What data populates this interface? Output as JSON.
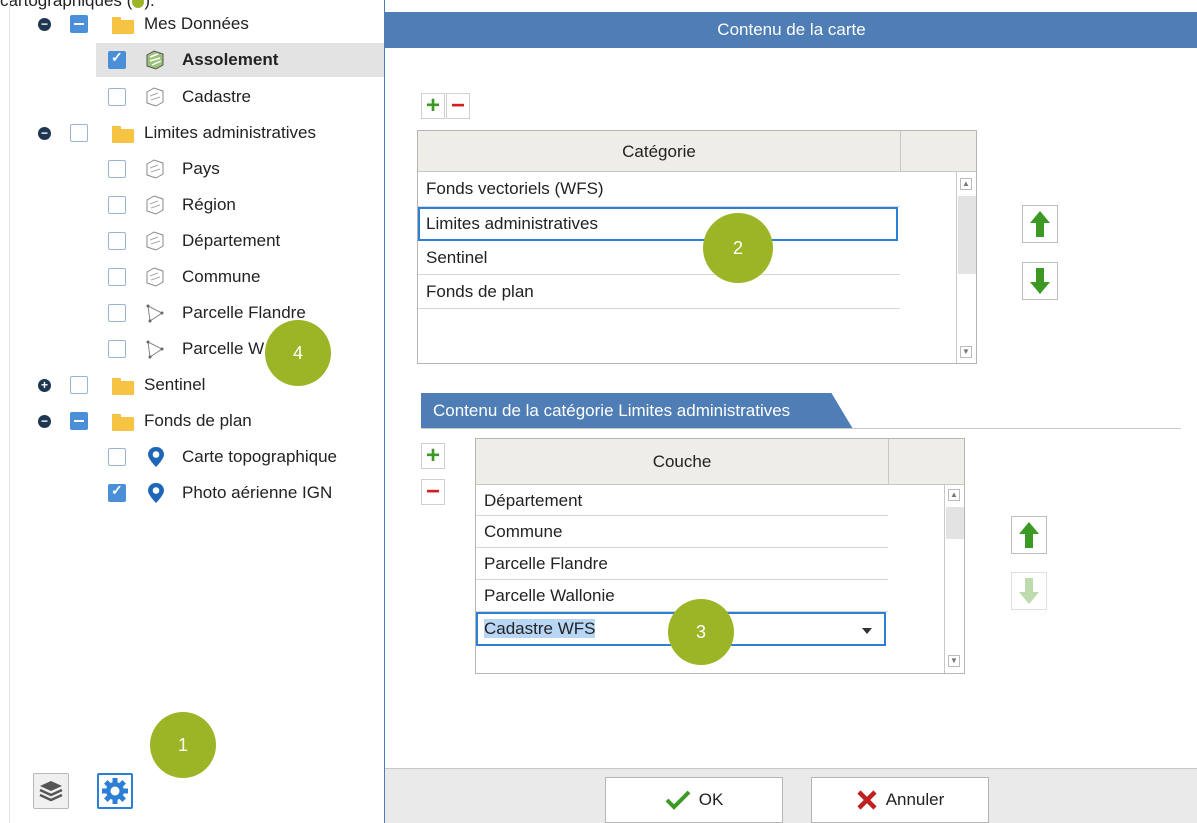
{
  "caption": {
    "text": "cartographiques (",
    "text_end": ")."
  },
  "tree": {
    "items": [
      {
        "label": "Mes Données",
        "checkbox": "partial",
        "toggle": "minus",
        "icon": "folder-icon"
      },
      {
        "label": "Assolement",
        "checkbox": "checked",
        "icon": "vector-layer-icon",
        "selected": true
      },
      {
        "label": "Cadastre",
        "checkbox": "unchecked",
        "icon": "vector-layer-icon"
      },
      {
        "label": "Limites administratives",
        "checkbox": "unchecked",
        "toggle": "minus",
        "icon": "folder-icon"
      },
      {
        "label": "Pays",
        "checkbox": "unchecked",
        "icon": "vector-layer-icon"
      },
      {
        "label": "Région",
        "checkbox": "unchecked",
        "icon": "vector-layer-icon"
      },
      {
        "label": "Département",
        "checkbox": "unchecked",
        "icon": "vector-layer-icon"
      },
      {
        "label": "Commune",
        "checkbox": "unchecked",
        "icon": "vector-layer-icon"
      },
      {
        "label": "Parcelle Flandre",
        "checkbox": "unchecked",
        "icon": "polygon-layer-icon"
      },
      {
        "label": "Parcelle W",
        "checkbox": "unchecked",
        "icon": "polygon-layer-icon"
      },
      {
        "label": "Sentinel",
        "checkbox": "unchecked",
        "toggle": "plus",
        "icon": "folder-icon"
      },
      {
        "label": "Fonds de plan",
        "checkbox": "partial",
        "toggle": "minus",
        "icon": "folder-icon"
      },
      {
        "label": "Carte topographique",
        "checkbox": "unchecked",
        "icon": "map-pin-icon"
      },
      {
        "label": "Photo aérienne IGN",
        "checkbox": "checked",
        "icon": "map-pin-icon"
      }
    ]
  },
  "badges": {
    "one": "1",
    "two": "2",
    "three": "3",
    "four": "4"
  },
  "dialog": {
    "title": "Contenu de la carte",
    "categories": {
      "header": "Catégorie",
      "rows": [
        "Fonds vectoriels (WFS)",
        "Limites administratives",
        "Sentinel",
        "Fonds de plan"
      ]
    },
    "tab_label": "Contenu de la catégorie Limites administratives",
    "layers": {
      "header": "Couche",
      "rows": [
        "Département",
        "Commune",
        "Parcelle Flandre",
        "Parcelle Wallonie"
      ],
      "editing_value": "Cadastre WFS"
    },
    "ok_label": "OK",
    "cancel_label": "Annuler"
  },
  "colors": {
    "accent": "#4f7db5",
    "badge": "#9bb526",
    "plus": "#3c9a24",
    "minus": "#d01f1f"
  }
}
